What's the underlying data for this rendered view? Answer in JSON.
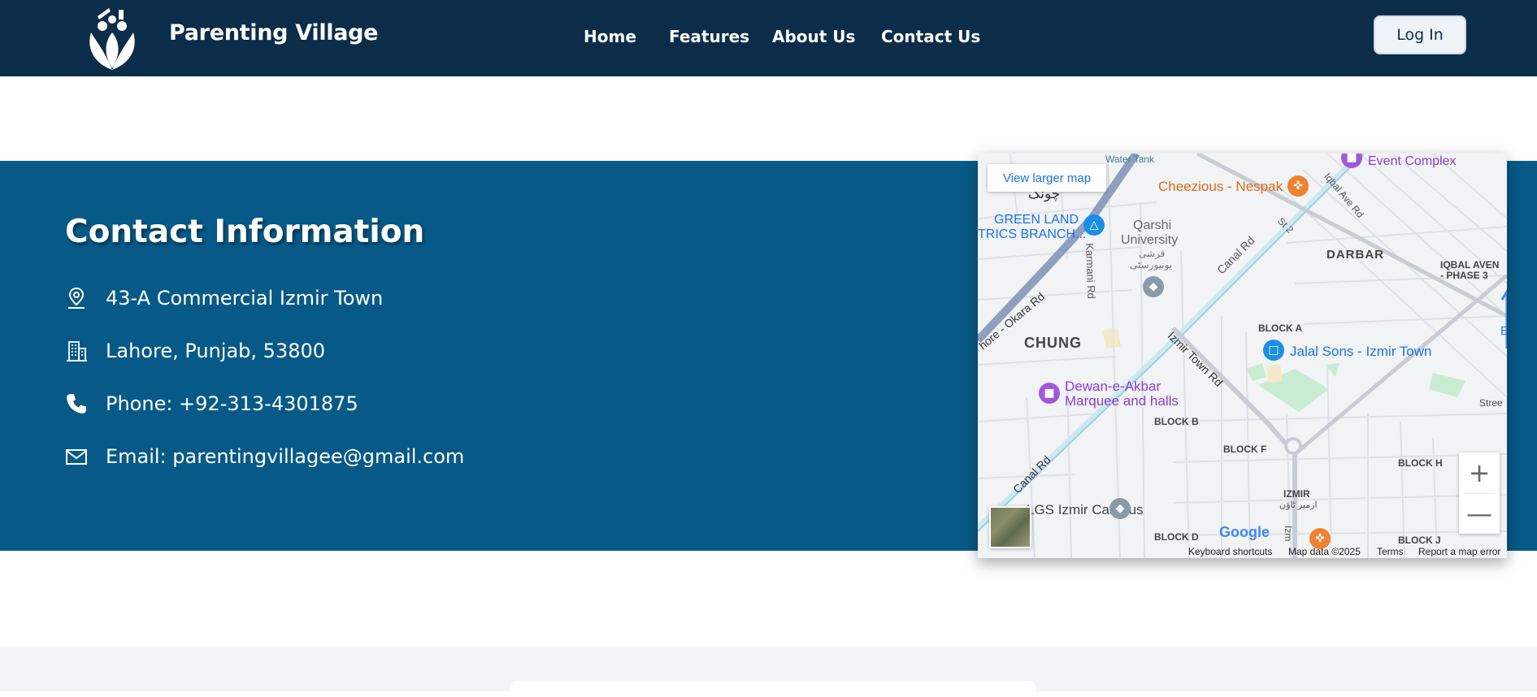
{
  "header": {
    "brand": "Parenting Village",
    "nav": [
      "Home",
      "Features",
      "About Us",
      "Contact Us"
    ],
    "login": "Log In"
  },
  "contact": {
    "title": "Contact Information",
    "address": "43-A Commercial Izmir Town",
    "city": "Lahore, Punjab, 53800",
    "phone": "Phone: +92-313-4301875",
    "email": "Email: parentingvillagee@gmail.com"
  },
  "map": {
    "view_larger": "View larger map",
    "google": "Google",
    "attributions": [
      "Keyboard shortcuts",
      "Map data ©2025",
      "Terms",
      "Report a map error"
    ],
    "labels": {
      "water_tank": "Water Tank",
      "event": "Event Complex",
      "cheezious": "Cheezious - Nespak",
      "chung_urdu": "چونک",
      "greenland": "GREEN LAND",
      "greenland2": "TRICS BRANCH...",
      "qarshi": "Qarshi",
      "qarshi2": "University",
      "qarshi_urdu": "قرشی",
      "qarshi_urdu2": "یونیورسٹی",
      "karmani": "Karmani Rd",
      "canal1": "Canal Rd",
      "st2": "St 2",
      "iqbal": "Iqbal Ave Rd",
      "darbar": "DARBAR",
      "iqbal_av": "IQBAL AVEN",
      "phase3": "- PHASE 3",
      "okara": "hore - Okara Rd",
      "chung": "CHUNG",
      "block_a": "BLOCK A",
      "izmir_rd": "Izmir Town Rd",
      "jalal": "Jalal Sons - Izmir Town",
      "dewan": "Dewan-e-Akbar",
      "dewan2": "Marquee and halls",
      "stree": "Stree",
      "block_b": "BLOCK B",
      "block_f": "BLOCK F",
      "block_h": "BLOCK H",
      "canal2": "Canal Rd",
      "izmir": "IZMIR",
      "izmir_urdu": "ازمیر ٹاؤن",
      "campus": "LGS Izmir Campus",
      "block_d": "BLOCK D",
      "izm": "Izm",
      "block_j": "BLOCK J",
      "e": "E"
    }
  }
}
